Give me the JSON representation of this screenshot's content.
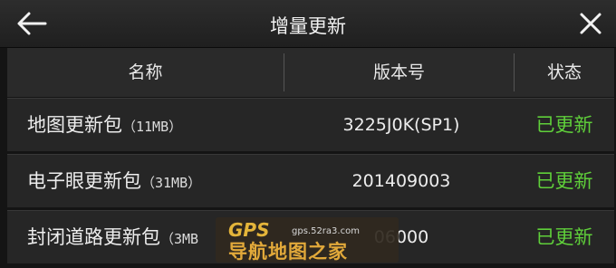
{
  "header": {
    "title": "增量更新",
    "back_icon": "arrow-left-icon",
    "close_icon": "close-x-icon"
  },
  "columns": {
    "name": "名称",
    "version": "版本号",
    "status": "状态"
  },
  "rows": [
    {
      "name": "地图更新包",
      "size": "（11MB）",
      "version": "3225J0K(SP1)",
      "status": "已更新"
    },
    {
      "name": "电子眼更新包",
      "size": "（31MB）",
      "version": "201409003",
      "status": "已更新"
    },
    {
      "name": "封闭道路更新包",
      "size": "（3MB",
      "version": "06000",
      "status": "已更新"
    }
  ],
  "watermark": {
    "logo_text": "GPS",
    "url": "gps.52ra3.com",
    "site_name": "导航地图之家"
  },
  "colors": {
    "status_green": "#5fcf3a",
    "background": "#141414",
    "row_bg": "#262626"
  }
}
